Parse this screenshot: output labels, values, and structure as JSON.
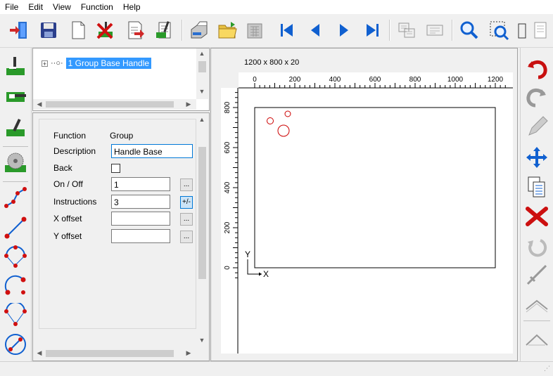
{
  "menu": [
    "File",
    "Edit",
    "View",
    "Function",
    "Help"
  ],
  "tree": {
    "item_label": "1 Group Base Handle",
    "expander": "+"
  },
  "properties": {
    "function_label": "Function",
    "function_value": "Group",
    "description_label": "Description",
    "description_value": "Handle Base",
    "back_label": "Back",
    "onoff_label": "On / Off",
    "onoff_value": "1",
    "instructions_label": "Instructions",
    "instructions_value": "3",
    "xoffset_label": "X offset",
    "xoffset_value": "",
    "yoffset_label": "Y offset",
    "yoffset_value": "",
    "ellipsis_label": "...",
    "plusminus_label": "+/-"
  },
  "canvas": {
    "dimensions_text": "1200 x 800 x 20",
    "x_ticks": [
      "0",
      "200",
      "400",
      "600",
      "800",
      "1000",
      "1200"
    ],
    "y_ticks": [
      "800",
      "600",
      "400",
      "200",
      "0"
    ],
    "axis_y_label": "Y",
    "axis_x_label": "X",
    "circle_color": "#cc0000"
  }
}
